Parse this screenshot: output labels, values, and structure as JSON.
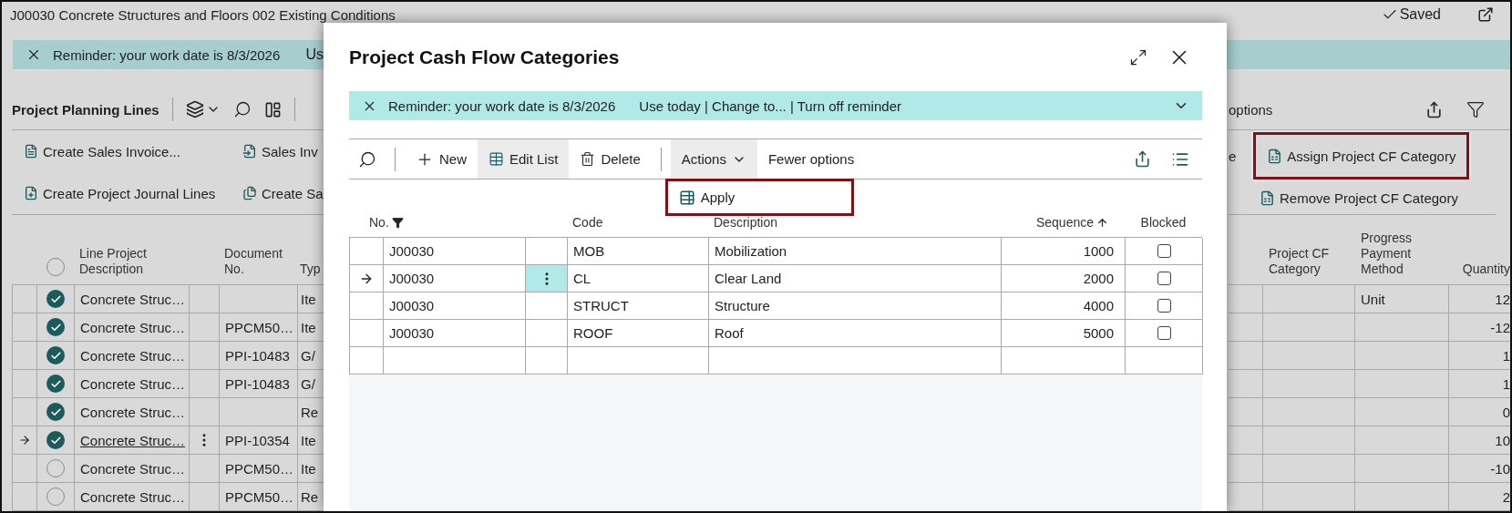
{
  "page": {
    "title": "J00030 Concrete Structures and Floors 002 Existing Conditions",
    "status": "Saved",
    "reminder": {
      "message": "Reminder: your work date is 8/3/2026",
      "links": "Us"
    },
    "lines": {
      "title": "Project Planning Lines",
      "more_options": "options",
      "select_all": false,
      "left_actions": [
        [
          "Create Sales Invoice...",
          "Sales Inv"
        ],
        [
          "Create Project Journal Lines",
          "Create Sa"
        ]
      ],
      "right_fragment": "e",
      "right_actions": [
        {
          "label": "Assign Project CF Category",
          "highlighted": true
        },
        {
          "label": "Remove Project CF Category",
          "highlighted": false
        }
      ],
      "left_columns": [
        "Line Project Description",
        "Document No.",
        "Typ"
      ],
      "right_columns": [
        "Project CF Category",
        "Progress Payment Method",
        "Quantity"
      ],
      "rows": [
        {
          "checked": true,
          "current": false,
          "description": "Concrete Struc…",
          "type": "Ite",
          "payment_method": "Unit",
          "quantity": "12"
        },
        {
          "checked": true,
          "current": false,
          "description": "Concrete Struc…",
          "document_no": "PPCM50…",
          "type": "Ite",
          "quantity": "-12"
        },
        {
          "checked": true,
          "current": false,
          "description": "Concrete Struc…",
          "document_no": "PPI-10483",
          "type": "G/",
          "quantity": "1"
        },
        {
          "checked": true,
          "current": false,
          "description": "Concrete Struc…",
          "document_no": "PPI-10483",
          "type": "G/",
          "quantity": "1"
        },
        {
          "checked": true,
          "current": false,
          "description": "Concrete Struc…",
          "type": "Re",
          "quantity": "0"
        },
        {
          "checked": true,
          "current": true,
          "description": "Concrete Struc…",
          "document_no": "PPI-10354",
          "type": "Ite",
          "quantity": "10"
        },
        {
          "checked": false,
          "current": false,
          "description": "Concrete Struc…",
          "document_no": "PPCM50…",
          "type": "Ite",
          "quantity": "-10"
        },
        {
          "checked": false,
          "current": false,
          "description": "Concrete Struc…",
          "document_no": "PPCM50…",
          "type": "Re",
          "quantity": "2"
        }
      ]
    }
  },
  "dialog": {
    "title": "Project Cash Flow Categories",
    "reminder": {
      "message": "Reminder: your work date is 8/3/2026",
      "links": "Use today | Change to... | Turn off reminder"
    },
    "toolbar": [
      {
        "label": "New",
        "kind": "new",
        "selected": false
      },
      {
        "label": "Edit List",
        "kind": "edit",
        "selected": true
      },
      {
        "label": "Delete",
        "kind": "delete",
        "selected": false
      },
      {
        "label": "Actions",
        "kind": "menu",
        "selected": true,
        "expanded": true
      },
      {
        "label": "Fewer options",
        "kind": "plain",
        "selected": false
      }
    ],
    "menu": [
      {
        "label": "Apply",
        "highlighted": true
      }
    ],
    "columns": [
      {
        "label": "No.",
        "filtered": true,
        "sorted": false
      },
      {
        "label": "Code",
        "filtered": false,
        "sorted": false
      },
      {
        "label": "Description",
        "filtered": false,
        "sorted": false
      },
      {
        "label": "Sequence",
        "filtered": false,
        "sorted": true
      },
      {
        "label": "Blocked",
        "filtered": false,
        "sorted": false
      }
    ],
    "rows": [
      {
        "no": "J00030",
        "code": "MOB",
        "description": "Mobilization",
        "sequence": "1000",
        "blocked": false,
        "current": false
      },
      {
        "no": "J00030",
        "code": "CL",
        "description": "Clear Land",
        "sequence": "2000",
        "blocked": false,
        "current": true
      },
      {
        "no": "J00030",
        "code": "STRUCT",
        "description": "Structure",
        "sequence": "4000",
        "blocked": false,
        "current": false
      },
      {
        "no": "J00030",
        "code": "ROOF",
        "description": "Roof",
        "sequence": "5000",
        "blocked": false,
        "current": false
      }
    ]
  }
}
